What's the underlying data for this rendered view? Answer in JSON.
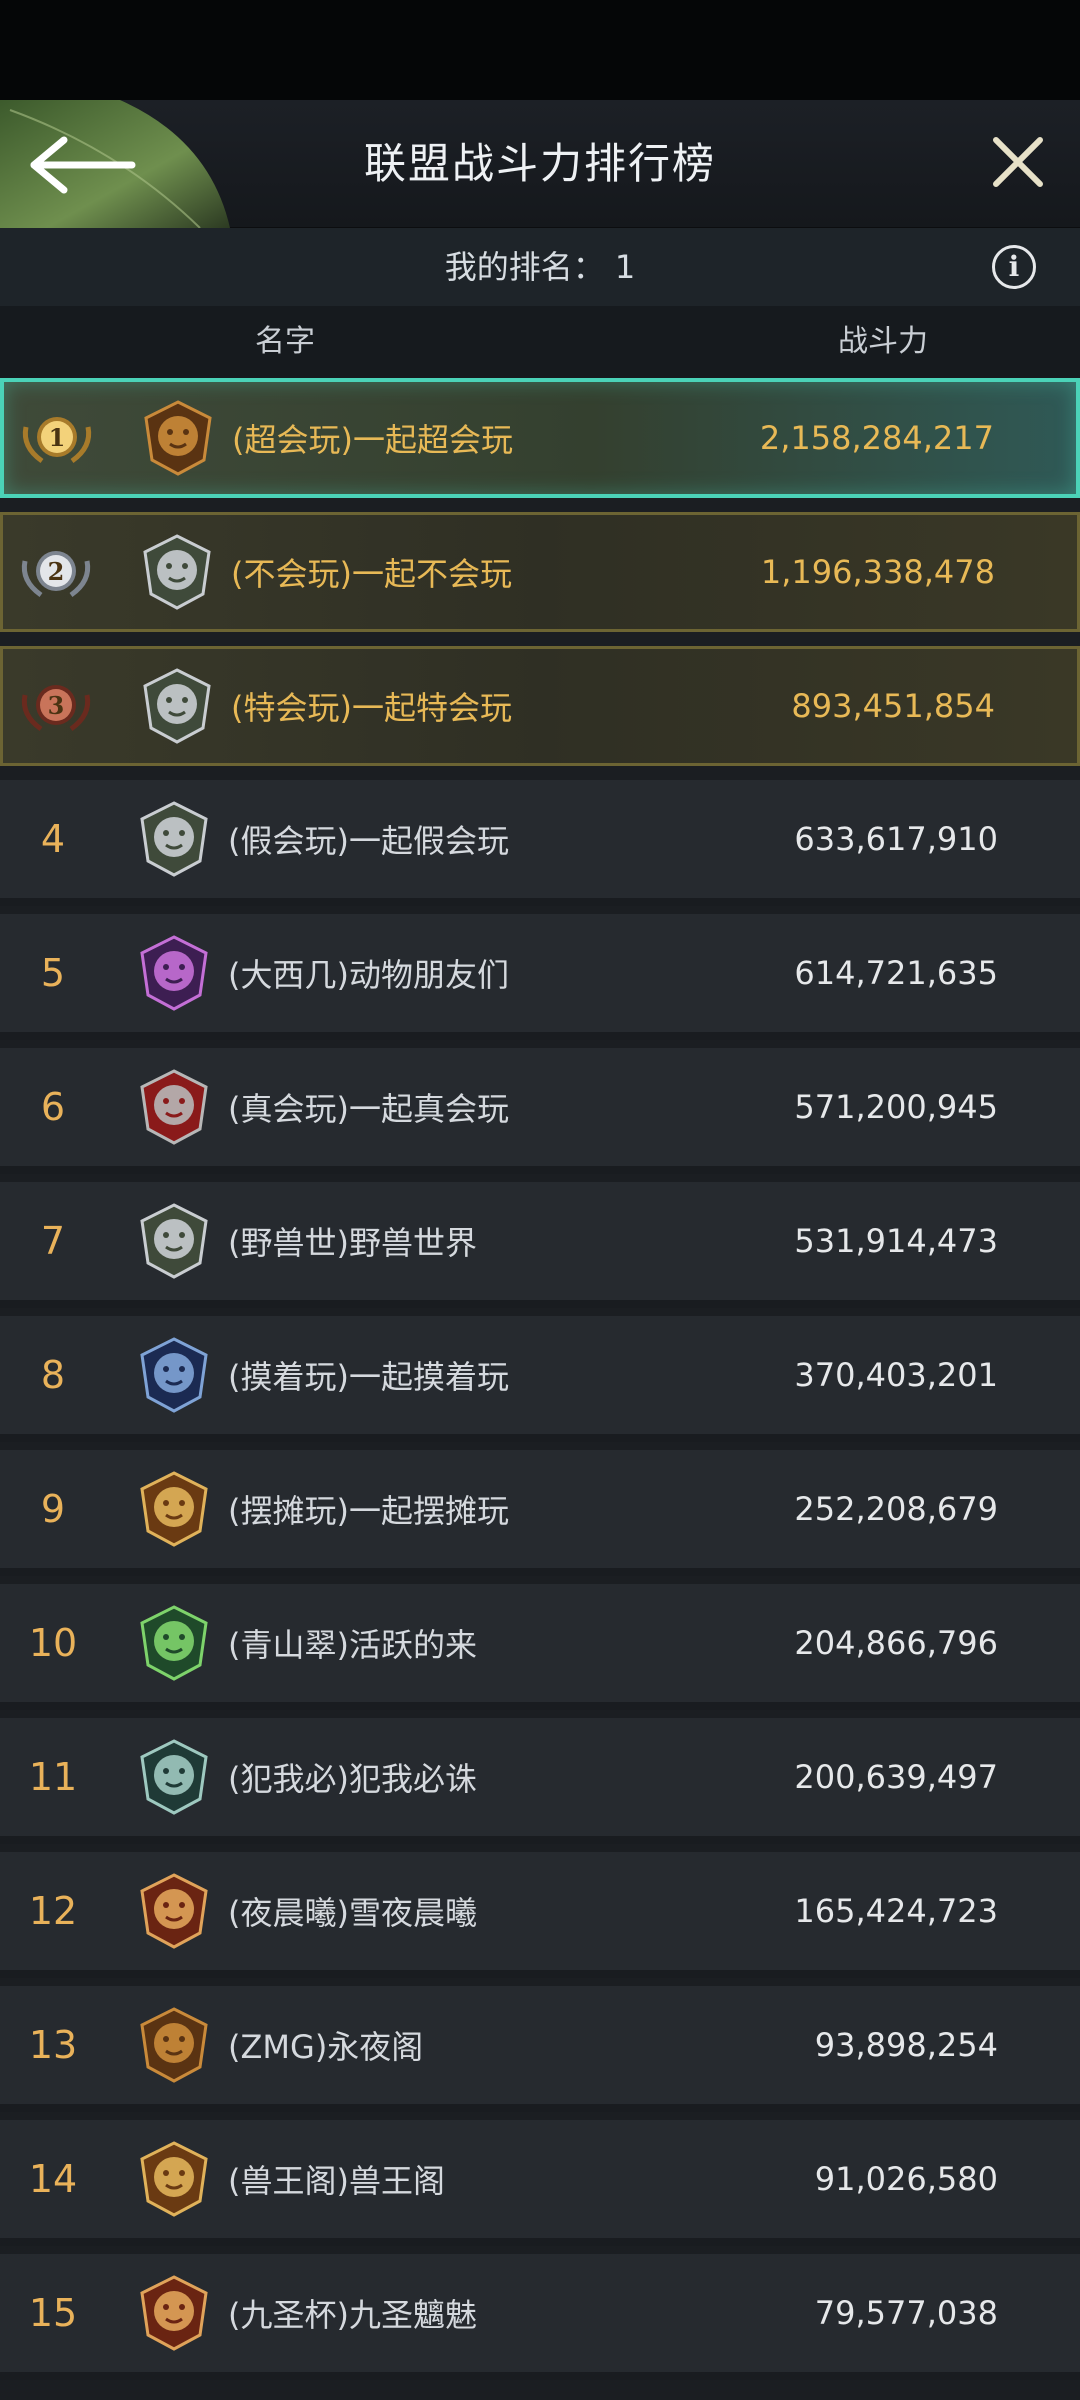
{
  "header": {
    "title": "联盟战斗力排行榜",
    "back_icon": "arrow-left-icon",
    "close_icon": "close-icon"
  },
  "my_rank": {
    "text": "我的排名： 1",
    "info_icon": "info-icon"
  },
  "columns": {
    "name": "名字",
    "power": "战斗力"
  },
  "colors": {
    "accent_gold": "#e8b956",
    "rank_orange": "#e9b25a",
    "first_border": "#4bd3b8",
    "top_border": "#6c6433"
  },
  "rows": [
    {
      "rank": "1",
      "medal": "gold-medal",
      "emblem": "bear-emblem",
      "name": "(超会玩)一起超会玩",
      "power": "2,158,284,217"
    },
    {
      "rank": "2",
      "medal": "silver-medal",
      "emblem": "elephant-emblem",
      "name": "(不会玩)一起不会玩",
      "power": "1,196,338,478"
    },
    {
      "rank": "3",
      "medal": "bronze-medal",
      "emblem": "elephant-emblem",
      "name": "(特会玩)一起特会玩",
      "power": "893,451,854"
    },
    {
      "rank": "4",
      "emblem": "elephant-emblem",
      "name": "(假会玩)一起假会玩",
      "power": "633,617,910"
    },
    {
      "rank": "5",
      "emblem": "wolf-emblem",
      "name": "(大西几)动物朋友们",
      "power": "614,721,635"
    },
    {
      "rank": "6",
      "emblem": "wolf-red-emblem",
      "name": "(真会玩)一起真会玩",
      "power": "571,200,945"
    },
    {
      "rank": "7",
      "emblem": "elephant-emblem",
      "name": "(野兽世)野兽世界",
      "power": "531,914,473"
    },
    {
      "rank": "8",
      "emblem": "gorilla-emblem",
      "name": "(摸着玩)一起摸着玩",
      "power": "370,403,201"
    },
    {
      "rank": "9",
      "emblem": "eagle-emblem",
      "name": "(摆摊玩)一起摆摊玩",
      "power": "252,208,679"
    },
    {
      "rank": "10",
      "emblem": "tree-emblem",
      "name": "(青山翠)活跃的来",
      "power": "204,866,796"
    },
    {
      "rank": "11",
      "emblem": "owl-emblem",
      "name": "(犯我必)犯我必诛",
      "power": "200,639,497"
    },
    {
      "rank": "12",
      "emblem": "deer-emblem",
      "name": "(夜晨曦)雪夜晨曦",
      "power": "165,424,723"
    },
    {
      "rank": "13",
      "emblem": "bear-emblem",
      "name": "(ZMG)永夜阁",
      "power": "93,898,254"
    },
    {
      "rank": "14",
      "emblem": "eagle-emblem",
      "name": "(兽王阁)兽王阁",
      "power": "91,026,580"
    },
    {
      "rank": "15",
      "emblem": "deer-emblem",
      "name": "(九圣杯)九圣魑魅",
      "power": "79,577,038"
    }
  ]
}
